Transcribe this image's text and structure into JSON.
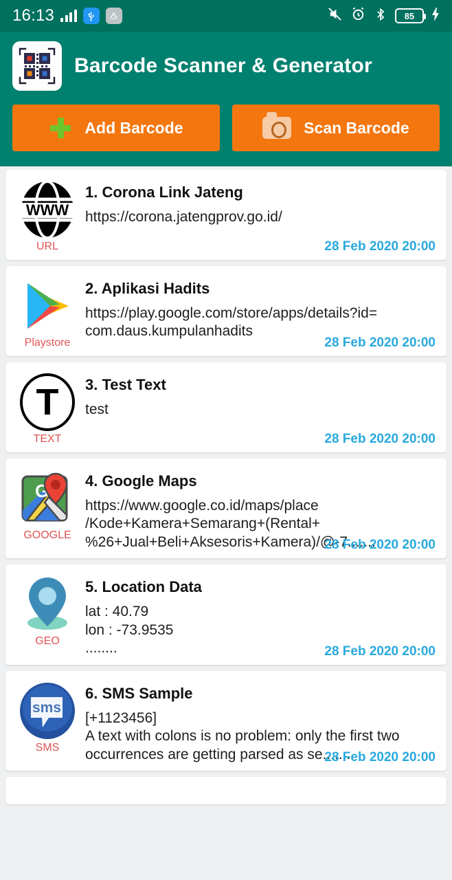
{
  "statusbar": {
    "time": "16:13",
    "battery_level": "85",
    "icons": [
      "signal-bars-icon",
      "usb-icon",
      "app-badge-icon",
      "mute-icon",
      "alarm-icon",
      "bluetooth-icon",
      "battery-icon",
      "charging-bolt-icon"
    ]
  },
  "header": {
    "title": "Barcode Scanner & Generator",
    "logo_icon": "qr-code-logo-icon",
    "background_color": "#00806f"
  },
  "actions": {
    "accent_color": "#f4760f",
    "add": {
      "label": "Add Barcode",
      "icon": "plus-icon"
    },
    "scan": {
      "label": "Scan Barcode",
      "icon": "camera-icon"
    }
  },
  "list": {
    "date_color": "#29a9dd",
    "type_color": "#e05252",
    "items": [
      {
        "index": "1.",
        "title": "1. Corona Link Jateng",
        "content": "https://corona.jatengprov.go.id/",
        "type": "URL",
        "icon": "www-globe-icon",
        "date": "28 Feb 2020 20:00"
      },
      {
        "index": "2.",
        "title": "2. Aplikasi Hadits",
        "content": "https://play.google.com/store/apps/details?id=\ncom.daus.kumpulanhadits",
        "type": "Playstore",
        "icon": "play-store-icon",
        "date": "28 Feb 2020 20:00"
      },
      {
        "index": "3.",
        "title": "3. Test Text",
        "content": "test",
        "type": "TEXT",
        "icon": "text-t-icon",
        "date": "28 Feb 2020 20:00"
      },
      {
        "index": "4.",
        "title": "4. Google Maps",
        "content": "https://www.google.co.id/maps/place\n/Kode+Kamera+Semarang+(Rental+\n%26+Jual+Beli+Aksesoris+Kamera)/@-7.......",
        "type": "GOOGLE",
        "icon": "google-maps-icon",
        "date": "28 Feb 2020 20:00"
      },
      {
        "index": "5.",
        "title": "5. Location Data",
        "content": "lat : 40.79\nlon : -73.9535\n........",
        "type": "GEO",
        "icon": "map-pin-icon",
        "date": "28 Feb 2020 20:00"
      },
      {
        "index": "6.",
        "title": "6. SMS Sample",
        "content": "[+1123456]\nA text with colons is no problem: only the first two\noccurrences are getting parsed as se.......",
        "type": "SMS",
        "icon": "sms-bubble-icon",
        "date": "28 Feb 2020 20:00"
      }
    ]
  }
}
